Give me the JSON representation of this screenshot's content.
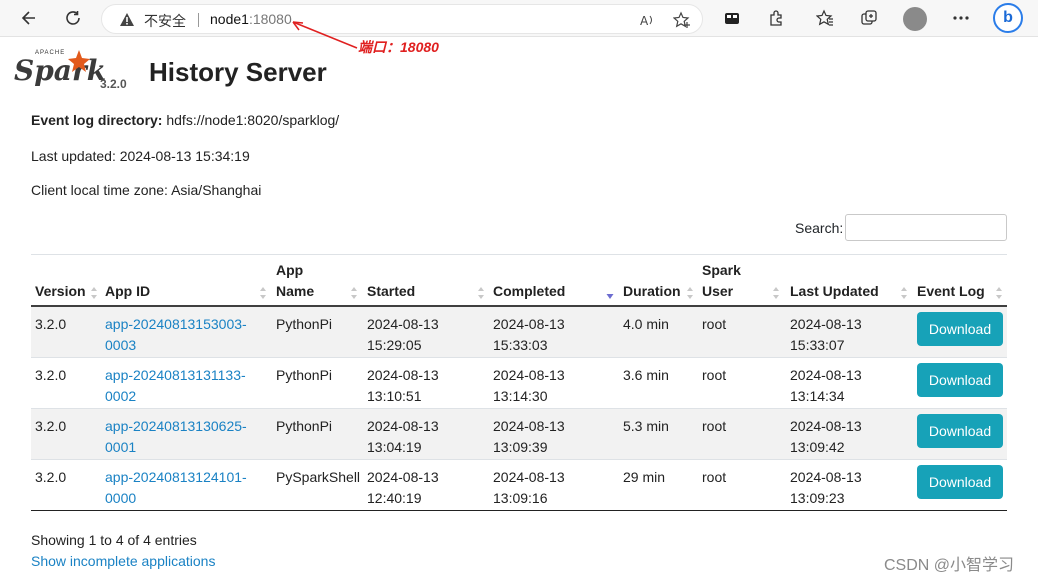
{
  "browser": {
    "insecure_label": "不安全",
    "url_host": "node1",
    "url_port": ":18080",
    "annotation": "端口：18080"
  },
  "header": {
    "logo_apache": "APACHE",
    "logo_text": "Spark",
    "version": "3.2.0",
    "title": "History Server"
  },
  "info": {
    "event_log_label": "Event log directory:",
    "event_log_value": "hdfs://node1:8020/sparklog/",
    "last_updated": "Last updated: 2024-08-13 15:34:19",
    "timezone": "Client local time zone: Asia/Shanghai"
  },
  "search": {
    "label": "Search:",
    "value": ""
  },
  "table": {
    "columns": [
      {
        "line1": "",
        "line2": "Version"
      },
      {
        "line1": "",
        "line2": "App ID"
      },
      {
        "line1": "App",
        "line2": "Name"
      },
      {
        "line1": "",
        "line2": "Started"
      },
      {
        "line1": "",
        "line2": "Completed"
      },
      {
        "line1": "",
        "line2": "Duration"
      },
      {
        "line1": "Spark",
        "line2": "User"
      },
      {
        "line1": "",
        "line2": "Last Updated"
      },
      {
        "line1": "",
        "line2": "Event Log"
      }
    ],
    "sorted_column": "Completed",
    "sort_direction": "descending",
    "rows": [
      {
        "version": "3.2.0",
        "app_id_1": "app-20240813153003-",
        "app_id_2": "0003",
        "name": "PythonPi",
        "started_1": "2024-08-13",
        "started_2": "15:29:05",
        "completed_1": "2024-08-13",
        "completed_2": "15:33:03",
        "duration": "4.0 min",
        "user": "root",
        "updated_1": "2024-08-13",
        "updated_2": "15:33:07",
        "action": "Download"
      },
      {
        "version": "3.2.0",
        "app_id_1": "app-20240813131133-",
        "app_id_2": "0002",
        "name": "PythonPi",
        "started_1": "2024-08-13",
        "started_2": "13:10:51",
        "completed_1": "2024-08-13",
        "completed_2": "13:14:30",
        "duration": "3.6 min",
        "user": "root",
        "updated_1": "2024-08-13",
        "updated_2": "13:14:34",
        "action": "Download"
      },
      {
        "version": "3.2.0",
        "app_id_1": "app-20240813130625-",
        "app_id_2": "0001",
        "name": "PythonPi",
        "started_1": "2024-08-13",
        "started_2": "13:04:19",
        "completed_1": "2024-08-13",
        "completed_2": "13:09:39",
        "duration": "5.3 min",
        "user": "root",
        "updated_1": "2024-08-13",
        "updated_2": "13:09:42",
        "action": "Download"
      },
      {
        "version": "3.2.0",
        "app_id_1": "app-20240813124101-",
        "app_id_2": "0000",
        "name": "PySparkShell",
        "started_1": "2024-08-13",
        "started_2": "12:40:19",
        "completed_1": "2024-08-13",
        "completed_2": "13:09:16",
        "duration": "29 min",
        "user": "root",
        "updated_1": "2024-08-13",
        "updated_2": "13:09:23",
        "action": "Download"
      }
    ]
  },
  "footer": {
    "entries": "Showing 1 to 4 of 4 entries",
    "incomplete_link": "Show incomplete applications",
    "watermark": "CSDN @小智学习"
  },
  "colors": {
    "link": "#1a82c4",
    "button": "#17a2b8",
    "annotation": "#e02020"
  }
}
